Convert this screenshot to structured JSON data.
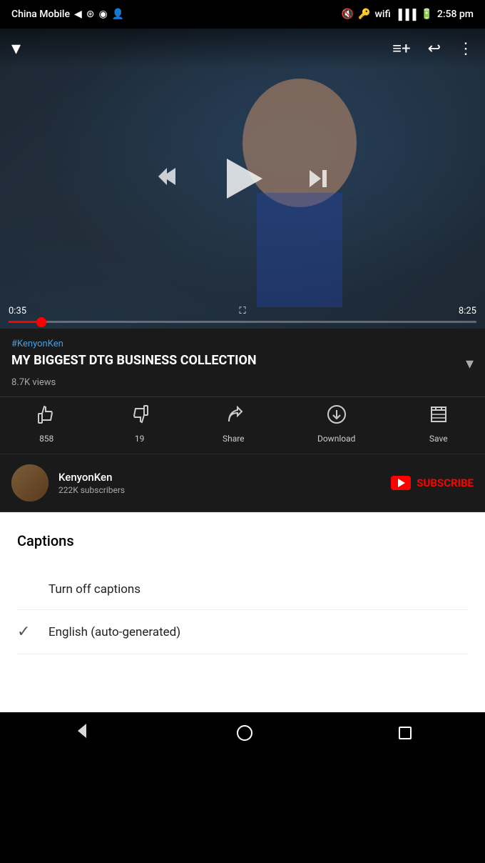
{
  "statusBar": {
    "carrier": "China Mobile",
    "time": "2:58 pm"
  },
  "video": {
    "currentTime": "0:35",
    "totalTime": "8:25",
    "progressPercent": 7,
    "thumbnailAlt": "KenyonKen DTG Business video thumbnail"
  },
  "videoInfo": {
    "channelTag": "#KenyonKen",
    "title": "MY BIGGEST DTG BUSINESS COLLECTION",
    "views": "8.7K views",
    "likeCount": "858",
    "dislikeCount": "19",
    "shareLabel": "Share",
    "downloadLabel": "Download",
    "saveLabel": "Save"
  },
  "channel": {
    "name": "KenyonKen",
    "subscribers": "222K subscribers",
    "subscribeLabel": "SUBSCRIBE"
  },
  "captions": {
    "title": "Captions",
    "options": [
      {
        "label": "Turn off captions",
        "checked": false
      },
      {
        "label": "English (auto-generated)",
        "checked": true
      }
    ]
  },
  "bottomNav": {
    "backLabel": "back",
    "homeLabel": "home",
    "recentLabel": "recent"
  }
}
